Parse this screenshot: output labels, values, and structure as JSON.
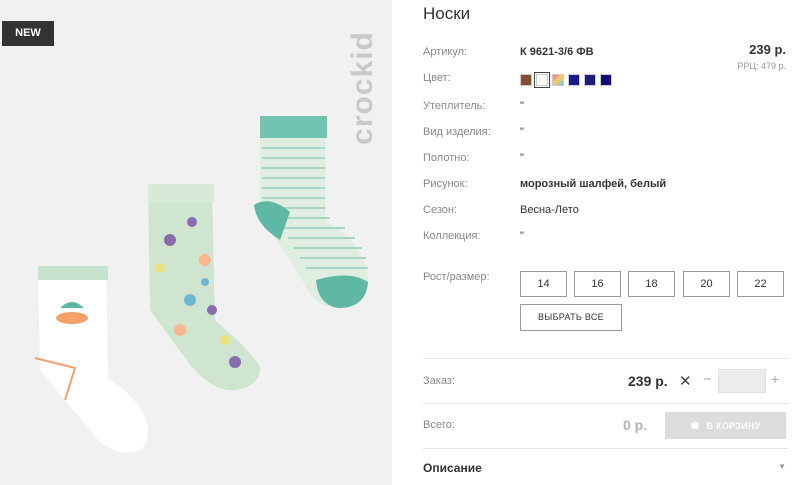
{
  "photo": {
    "badge": "NEW",
    "brand": "crockid"
  },
  "product": {
    "title": "Носки",
    "price": "239 р.",
    "rrp": "РРЦ: 479 р.",
    "attributes": [
      {
        "label": "Артикул:",
        "value": "К 9621-3/6 ФВ"
      },
      {
        "label": "Цвет:",
        "value": ""
      },
      {
        "label": "Утеплитель:",
        "value": "\""
      },
      {
        "label": "Вид изделия:",
        "value": "\""
      },
      {
        "label": "Полотно:",
        "value": "\""
      },
      {
        "label": "Рисунок:",
        "value": "морозный шалфей, белый"
      },
      {
        "label": "Сезон:",
        "value": "Весна-Лето"
      },
      {
        "label": "Коллекция:",
        "value": "\""
      }
    ],
    "color_swatches": [
      "#8b4a2f",
      "#ffffff",
      "#e2c06a",
      "#1a1a8c",
      "#1f1a7a",
      "#120f6e"
    ],
    "size_label": "Рост/размер:",
    "sizes": [
      "14",
      "16",
      "18",
      "20",
      "22"
    ],
    "select_all": "ВЫБРАТЬ ВСЕ"
  },
  "order": {
    "label": "Заказ:",
    "price": "239 р.",
    "minus": "−",
    "plus": "+",
    "quantity": ""
  },
  "total": {
    "label": "Всего:",
    "sum": "0 р.",
    "cart_button": "В КОРЗИНУ"
  },
  "description": {
    "label": "Описание"
  }
}
